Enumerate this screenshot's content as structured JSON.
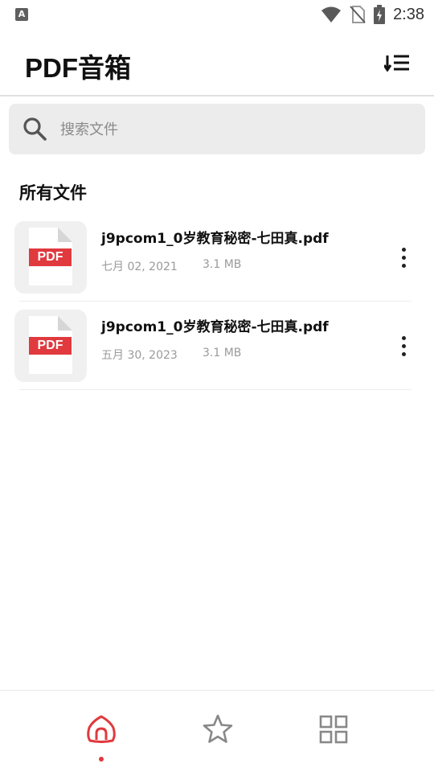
{
  "status_bar": {
    "time": "2:38",
    "left_icon": "A"
  },
  "app_bar": {
    "title": "PDF音箱",
    "sort_icon": "sort-icon"
  },
  "search": {
    "placeholder": "搜索文件",
    "value": ""
  },
  "section": {
    "title": "所有文件"
  },
  "files": [
    {
      "name": "j9pcom1_0岁教育秘密-七田真.pdf",
      "date": "七月 02, 2021",
      "size": "3.1 MB",
      "badge": "PDF"
    },
    {
      "name": "j9pcom1_0岁教育秘密-七田真.pdf",
      "date": "五月 30, 2023",
      "size": "3.1 MB",
      "badge": "PDF"
    }
  ],
  "bottom_nav": {
    "items": [
      "home-icon",
      "star-icon",
      "grid-icon"
    ],
    "active": "home-icon",
    "accent": "#e0393e"
  }
}
